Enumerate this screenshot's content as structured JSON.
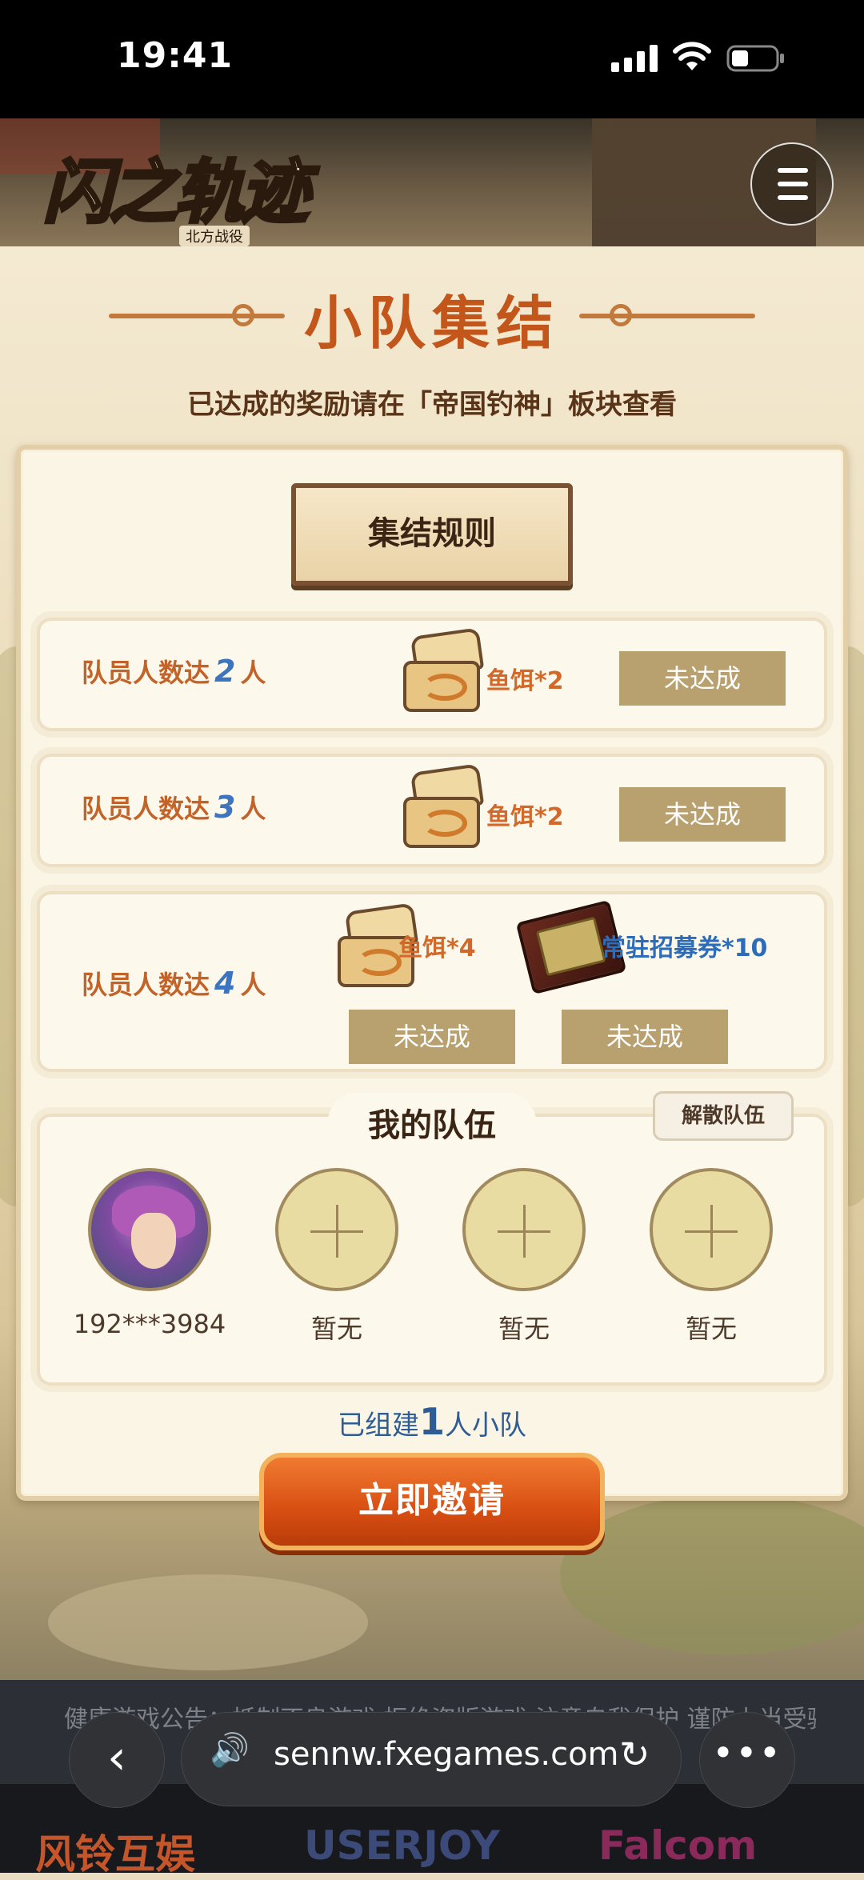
{
  "status_bar": {
    "time": "19:41"
  },
  "header": {
    "logo_title": "闪之轨迹",
    "logo_subtitle": "北方战役",
    "menu_icon": "hamburger-menu-icon"
  },
  "page": {
    "title": "小队集结",
    "subtitle": "已达成的奖励请在「帝国钓神」板块查看",
    "rules_label": "集结规则"
  },
  "rewards": [
    {
      "condition_prefix": "队员人数达",
      "count": "2",
      "unit": "人",
      "items": [
        {
          "label": "鱼饵*2",
          "icon": "bait-chest-icon",
          "status": "未达成"
        }
      ]
    },
    {
      "condition_prefix": "队员人数达",
      "count": "3",
      "unit": "人",
      "items": [
        {
          "label": "鱼饵*2",
          "icon": "bait-chest-icon",
          "status": "未达成"
        }
      ]
    },
    {
      "condition_prefix": "队员人数达",
      "count": "4",
      "unit": "人",
      "items": [
        {
          "label": "鱼饵*4",
          "icon": "bait-chest-icon",
          "status": "未达成"
        },
        {
          "label": "常驻招募券*10",
          "icon": "recruit-ticket-icon",
          "status": "未达成"
        }
      ]
    }
  ],
  "team": {
    "title": "我的队伍",
    "disband_label": "解散队伍",
    "members": [
      {
        "name": "192***3984",
        "filled": true
      },
      {
        "name": "暂无",
        "filled": false
      },
      {
        "name": "暂无",
        "filled": false
      },
      {
        "name": "暂无",
        "filled": false
      }
    ],
    "count_prefix": "已组建",
    "count_value": "1",
    "count_suffix": "人小队",
    "invite_label": "立即邀请"
  },
  "notice": {
    "text": "健康游戏公告：抵制不良游戏 拒绝盗版游戏 注意自我保护 谨防上当受骗"
  },
  "footer": {
    "brands": [
      "风铃互娱",
      "USERJOY",
      "Falcom"
    ]
  },
  "browser": {
    "url": "sennw.fxegames.com"
  }
}
